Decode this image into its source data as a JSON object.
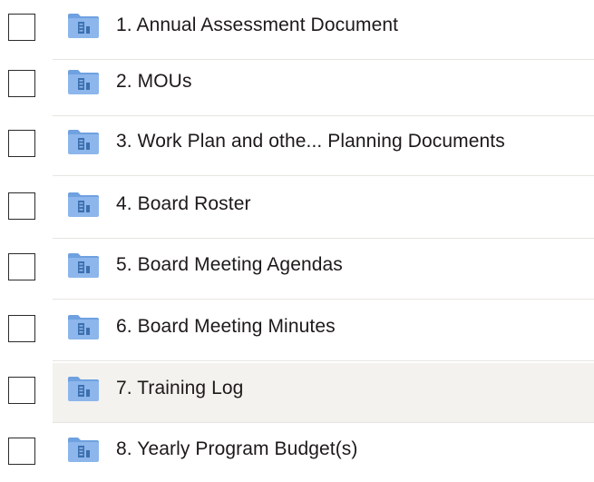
{
  "file_list": {
    "items": [
      {
        "name": "1. Annual Assessment Document",
        "type": "folder",
        "selected": false
      },
      {
        "name": "2. MOUs",
        "type": "folder",
        "selected": false
      },
      {
        "name": "3. Work Plan and othe... Planning Documents",
        "type": "folder",
        "selected": false
      },
      {
        "name": "4. Board Roster",
        "type": "folder",
        "selected": false
      },
      {
        "name": "5. Board Meeting Agendas",
        "type": "folder",
        "selected": false
      },
      {
        "name": "6. Board Meeting Minutes",
        "type": "folder",
        "selected": false
      },
      {
        "name": "7. Training Log",
        "type": "folder",
        "selected": false,
        "hovered": true
      },
      {
        "name": "8. Yearly Program Budget(s)",
        "type": "folder",
        "selected": false
      }
    ],
    "icon": "shared-folder-icon",
    "colors": {
      "folder_body": "#8cb6ec",
      "folder_tab": "#6fa1e0",
      "folder_glyph": "#3d6fae",
      "hover_bg": "#f3f2ef",
      "divider": "#e7e5e1",
      "text": "#1e1919"
    }
  }
}
